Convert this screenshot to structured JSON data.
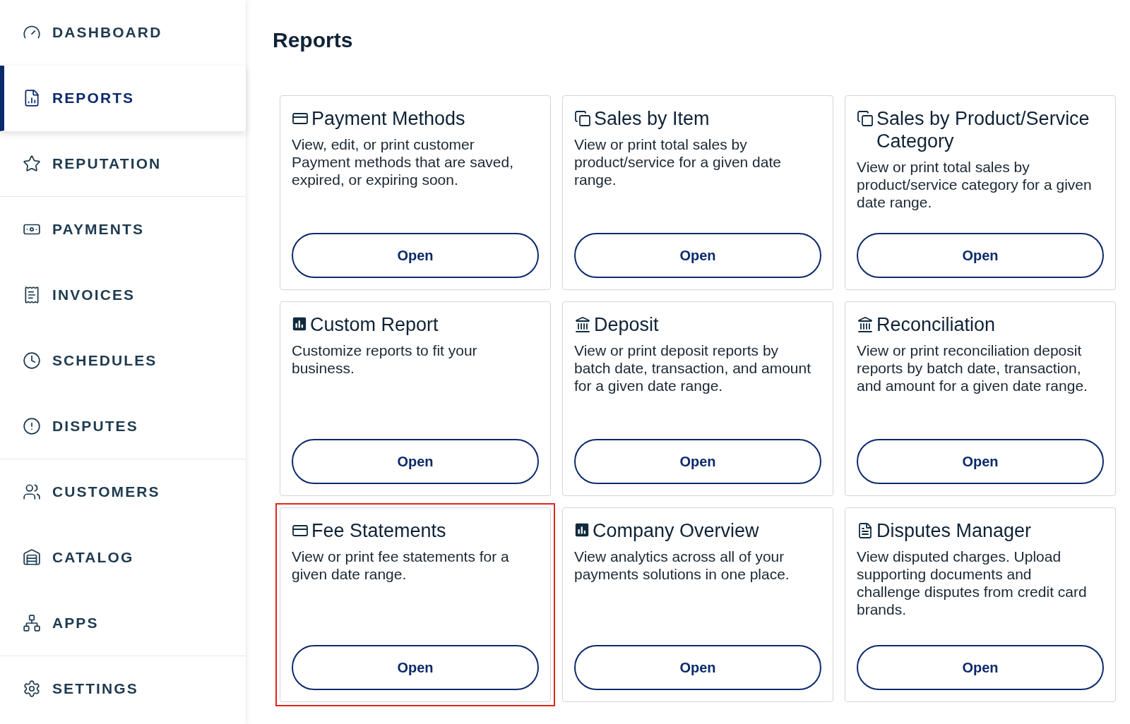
{
  "sidebar": {
    "items": [
      {
        "label": "DASHBOARD",
        "selected": false,
        "divider_after": false
      },
      {
        "label": "REPORTS",
        "selected": true,
        "divider_after": false
      },
      {
        "label": "REPUTATION",
        "selected": false,
        "divider_after": true
      },
      {
        "label": "PAYMENTS",
        "selected": false,
        "divider_after": false
      },
      {
        "label": "INVOICES",
        "selected": false,
        "divider_after": false
      },
      {
        "label": "SCHEDULES",
        "selected": false,
        "divider_after": false
      },
      {
        "label": "DISPUTES",
        "selected": false,
        "divider_after": true
      },
      {
        "label": "CUSTOMERS",
        "selected": false,
        "divider_after": false
      },
      {
        "label": "CATALOG",
        "selected": false,
        "divider_after": false
      },
      {
        "label": "APPS",
        "selected": false,
        "divider_after": true
      },
      {
        "label": "SETTINGS",
        "selected": false,
        "divider_after": false
      }
    ]
  },
  "page": {
    "title": "Reports"
  },
  "cards": [
    {
      "title": "Payment Methods",
      "description": "View, edit, or print customer Payment methods that are saved, expired, or expiring soon.",
      "button": "Open",
      "highlighted": false
    },
    {
      "title": "Sales by Item",
      "description": "View or print total sales by product/service for a given date range.",
      "button": "Open",
      "highlighted": false
    },
    {
      "title": "Sales by Product/Service Category",
      "description": "View or print total sales by product/service category for a given date range.",
      "button": "Open",
      "highlighted": false
    },
    {
      "title": "Custom Report",
      "description": "Customize reports to fit your business.",
      "button": "Open",
      "highlighted": false
    },
    {
      "title": "Deposit",
      "description": "View or print deposit reports by batch date, transaction, and amount for a given date range.",
      "button": "Open",
      "highlighted": false
    },
    {
      "title": "Reconciliation",
      "description": "View or print reconciliation deposit reports by batch date, transaction, and amount for a given date range.",
      "button": "Open",
      "highlighted": false
    },
    {
      "title": "Fee Statements",
      "description": "View or print fee statements for a given date range.",
      "button": "Open",
      "highlighted": true
    },
    {
      "title": "Company Overview",
      "description": "View analytics across all of your payments solutions in one place.",
      "button": "Open",
      "highlighted": false
    },
    {
      "title": "Disputes Manager",
      "description": "View disputed charges. Upload supporting documents and challenge disputes from credit card brands.",
      "button": "Open",
      "highlighted": false
    }
  ]
}
